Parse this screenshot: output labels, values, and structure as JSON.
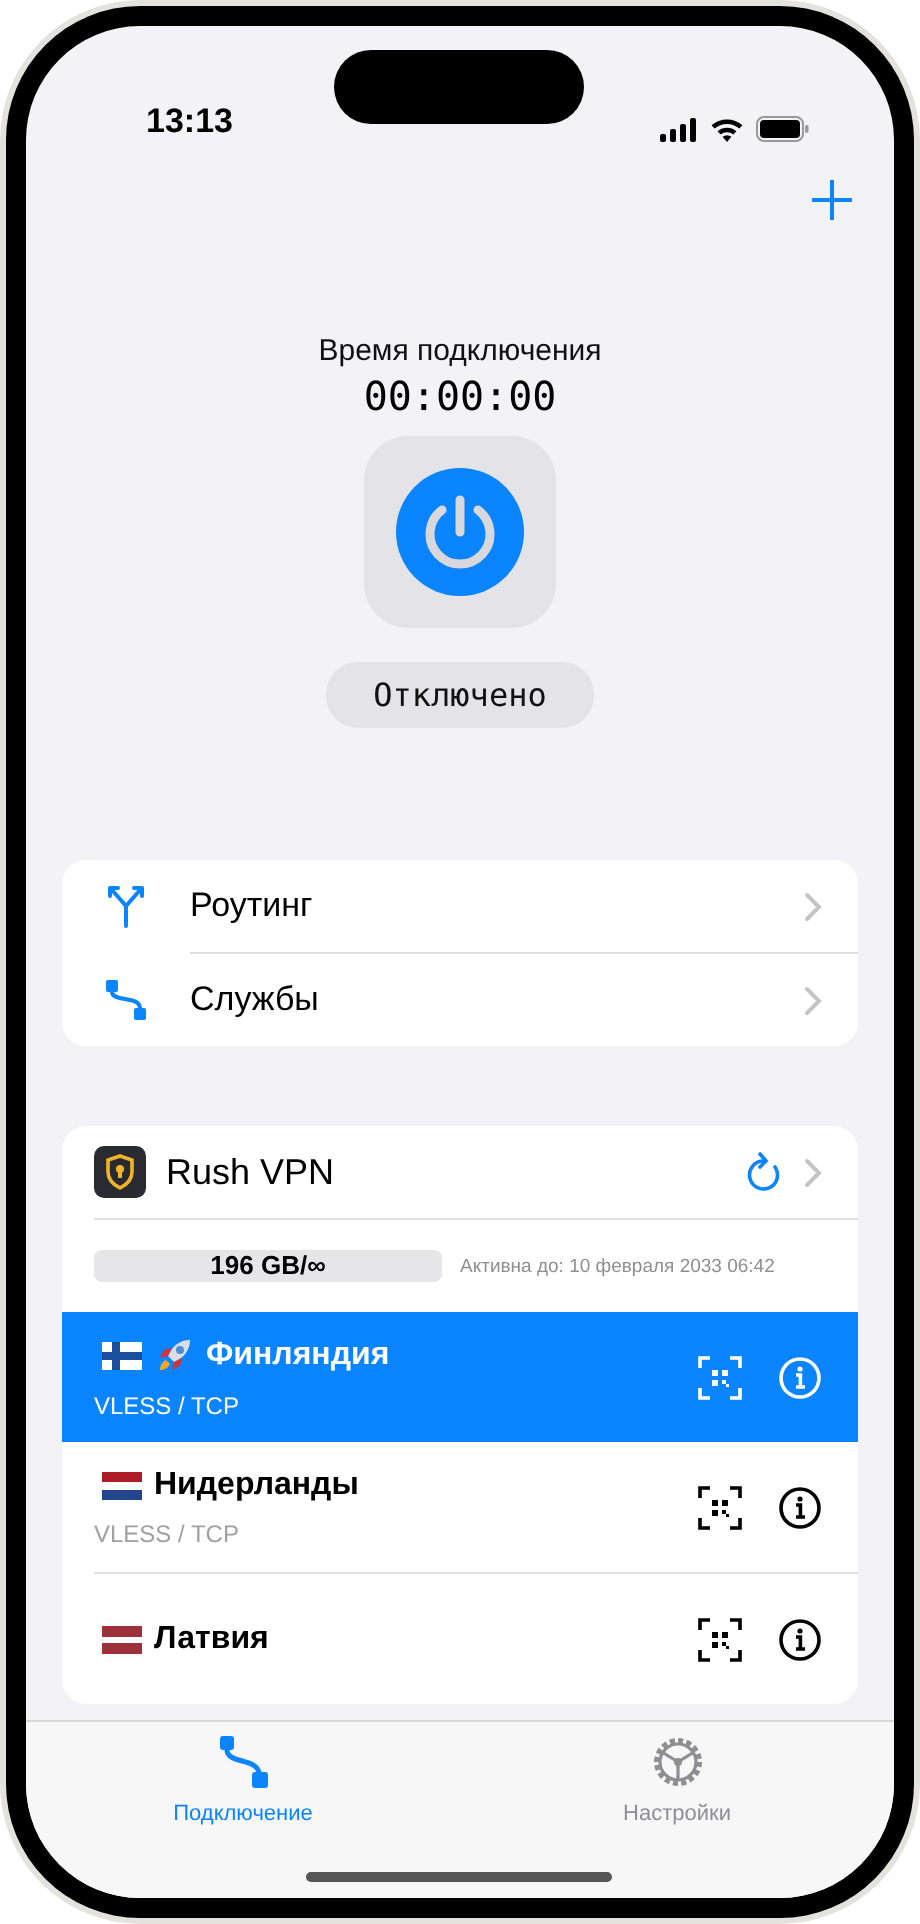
{
  "status_bar": {
    "time": "13:13"
  },
  "connection": {
    "label": "Время подключения",
    "timer": "00:00:00",
    "status": "Отключено"
  },
  "menu": [
    {
      "kind": "routing",
      "label": "Роутинг"
    },
    {
      "kind": "services",
      "label": "Службы"
    }
  ],
  "subscription": {
    "name": "Rush VPN",
    "usage": "196 GB/∞",
    "expires": "Активна до: 10 февраля 2033 06:42"
  },
  "servers": [
    {
      "kind": "fi",
      "fast": true,
      "name": "Финляндия",
      "protocol": "VLESS / TCP",
      "selected": true
    },
    {
      "kind": "nl",
      "fast": false,
      "name": "Нидерланды",
      "protocol": "VLESS / TCP",
      "selected": false
    },
    {
      "kind": "lv",
      "fast": false,
      "name": "Латвия",
      "selected": false
    }
  ],
  "tabs": [
    {
      "kind": "connection",
      "label": "Подключение",
      "selected": true
    },
    {
      "kind": "settings",
      "label": "Настройки",
      "selected": false
    }
  ]
}
